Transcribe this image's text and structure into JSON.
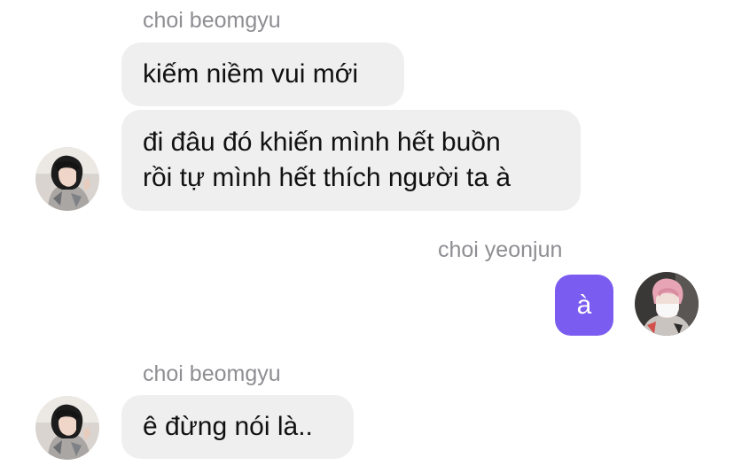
{
  "messages": [
    {
      "sender": "choi beomgyu",
      "lines": [
        "kiếm niềm vui mới"
      ]
    },
    {
      "lines": [
        "đi đâu đó khiến mình hết buồn",
        "rồi tự mình hết thích người ta à"
      ]
    },
    {
      "sender": "choi yeonjun",
      "lines": [
        "à"
      ]
    },
    {
      "sender": "choi beomgyu",
      "lines": [
        "ê đừng nói là.."
      ]
    }
  ],
  "colors": {
    "incoming_bubble": "#efefef",
    "outgoing_bubble": "#7b5cf0",
    "sender_name": "#8e8e93"
  }
}
